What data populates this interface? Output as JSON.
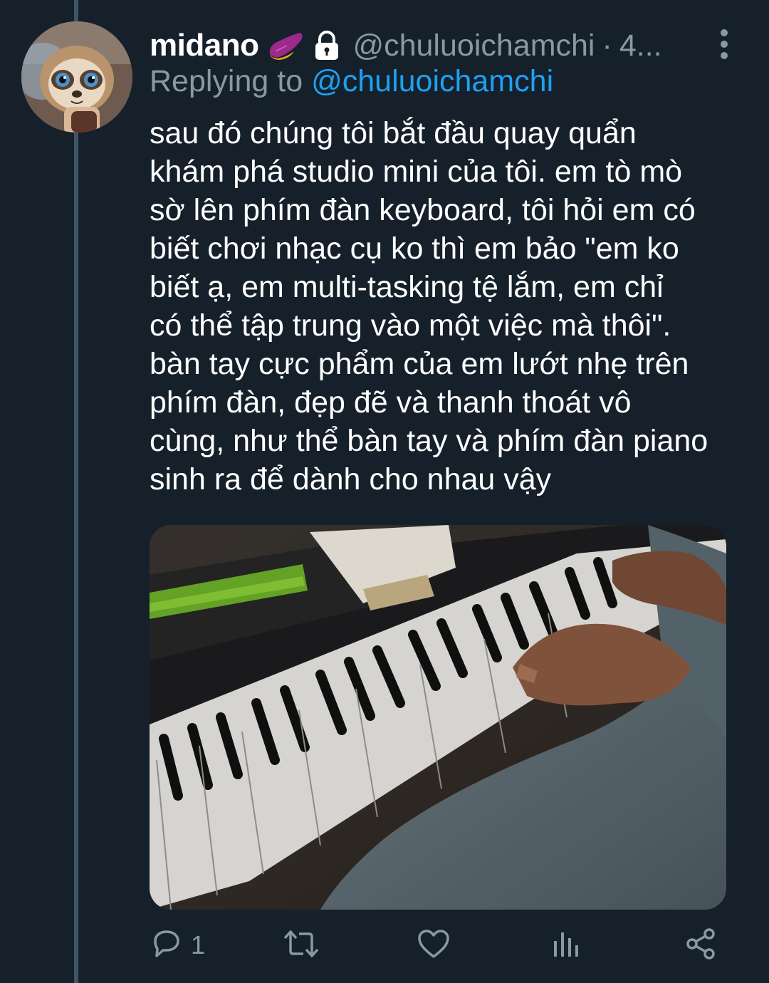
{
  "tweet": {
    "display_name": "midano",
    "handle": "@chuluoichamchi",
    "separator": "·",
    "time": "4...",
    "replying_prefix": "Replying to",
    "replying_handle": "@chuluoichamchi",
    "text_lines": [
      "sau đó chúng tôi bắt đầu quay quẩn",
      "khám phá studio mini của tôi. em tò mò",
      "sờ lên phím đàn keyboard, tôi hỏi em có",
      "biết chơi nhạc cụ ko thì em bảo \"em ko",
      "biết ạ, em multi-tasking tệ lắm, em chỉ",
      "có thể tập trung vào một việc mà thôi\".",
      "bàn tay cực phẩm của em lướt nhẹ trên",
      "phím đàn, đẹp đẽ và thanh thoát vô",
      "cùng, như thể bàn tay và phím đàn piano",
      "sinh ra để dành cho nhau vậy"
    ]
  },
  "actions": {
    "reply_count": "1",
    "retweet_count": "",
    "like_count": ""
  },
  "icons": {
    "emoji": "sweet-potato-emoji",
    "lock": "lock-icon",
    "more": "more-vertical-icon",
    "reply": "reply-icon",
    "retweet": "retweet-icon",
    "like": "heart-icon",
    "analytics": "analytics-icon",
    "share": "share-icon"
  },
  "colors": {
    "background": "#15202b",
    "muted": "#8899a6",
    "link": "#1da1f2",
    "text": "#ffffff"
  }
}
